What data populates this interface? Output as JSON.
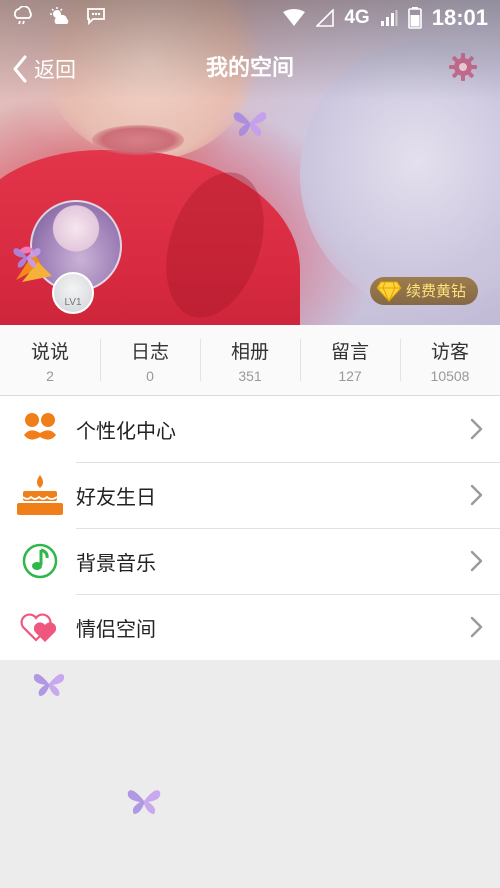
{
  "status_bar": {
    "network": "4G",
    "time": "18:01"
  },
  "nav": {
    "back_label": "返回",
    "title": "我的空间"
  },
  "profile": {
    "level": "LV1",
    "vip_renew_label": "续费黄钻"
  },
  "stats": [
    {
      "label": "说说",
      "count": "2"
    },
    {
      "label": "日志",
      "count": "0"
    },
    {
      "label": "相册",
      "count": "351"
    },
    {
      "label": "留言",
      "count": "127"
    },
    {
      "label": "访客",
      "count": "10508"
    }
  ],
  "menu": [
    {
      "label": "个性化中心",
      "icon": "mustache-icon"
    },
    {
      "label": "好友生日",
      "icon": "birthday-cake-icon"
    },
    {
      "label": "背景音乐",
      "icon": "music-note-icon"
    },
    {
      "label": "情侣空间",
      "icon": "couple-hearts-icon"
    }
  ],
  "colors": {
    "accent_orange": "#f07f1a",
    "music_green": "#2fb84a",
    "heart_pink": "#f0577f",
    "vip_gold": "#ffe27a"
  }
}
